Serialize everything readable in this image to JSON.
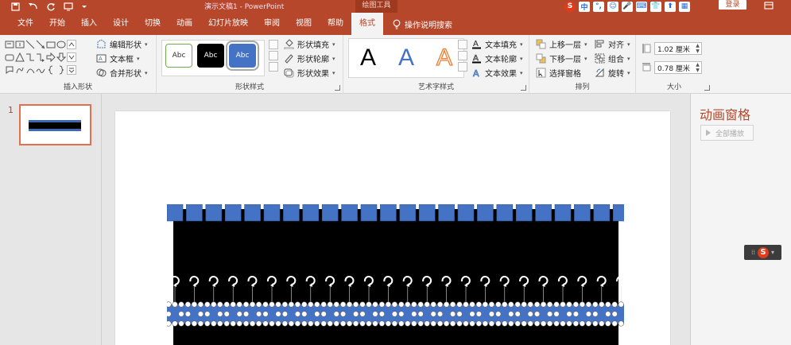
{
  "window": {
    "title": "演示文稿1 - PowerPoint",
    "context_tab_title": "绘图工具",
    "login": "登录"
  },
  "ribbon_tabs": [
    "文件",
    "开始",
    "插入",
    "设计",
    "切换",
    "动画",
    "幻灯片放映",
    "审阅",
    "视图",
    "帮助",
    "格式"
  ],
  "active_tab": "格式",
  "tell_me": "操作说明搜索",
  "ime_tools": [
    "S",
    "中",
    "°,",
    "☺",
    "🎤",
    "⌨",
    "👕",
    "⬆",
    "▦"
  ],
  "groups": {
    "insert_shapes": {
      "label": "插入形状",
      "edit_shape": "编辑形状",
      "text_box": "文本框",
      "merge_shapes": "合并形状"
    },
    "shape_styles": {
      "label": "形状样式",
      "samples": [
        "Abc",
        "Abc",
        "Abc"
      ],
      "fill": "形状填充",
      "outline": "形状轮廓",
      "effects": "形状效果"
    },
    "wordart_styles": {
      "label": "艺术字样式",
      "samples": [
        "A",
        "A",
        "A"
      ],
      "text_fill": "文本填充",
      "text_outline": "文本轮廓",
      "text_effects": "文本效果"
    },
    "arrange": {
      "label": "排列",
      "bring_forward": "上移一层",
      "send_backward": "下移一层",
      "selection_pane": "选择窗格",
      "align": "对齐",
      "group": "组合",
      "rotate": "旋转"
    },
    "size": {
      "label": "大小",
      "height": "1.02 厘米",
      "width": "0.78 厘米"
    }
  },
  "slides_pane": {
    "slide_number": "1"
  },
  "animation_pane": {
    "title": "动画窗格",
    "play_all": "全部播放"
  },
  "colors": {
    "brand": "#b7472a",
    "shape_blue": "#4472c4",
    "shape_black": "#000000"
  }
}
